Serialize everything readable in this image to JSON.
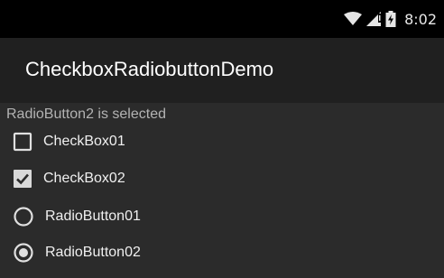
{
  "status_bar": {
    "time": "8:02",
    "icons": [
      "wifi-icon",
      "cell-signal-icon",
      "battery-charging-icon"
    ]
  },
  "app_bar": {
    "title": "CheckboxRadiobuttonDemo"
  },
  "content": {
    "status_message": "RadioButton2 is selected",
    "checkboxes": [
      {
        "label": "CheckBox01",
        "checked": false
      },
      {
        "label": "CheckBox02",
        "checked": true
      }
    ],
    "radio_buttons": [
      {
        "label": "RadioButton01",
        "selected": false
      },
      {
        "label": "RadioButton02",
        "selected": true
      }
    ]
  },
  "colors": {
    "background": "#2b2b2b",
    "status_bar": "#000000",
    "app_bar": "#202020",
    "control": "#e0e0e0",
    "secondary_text": "#b3b3b3"
  }
}
